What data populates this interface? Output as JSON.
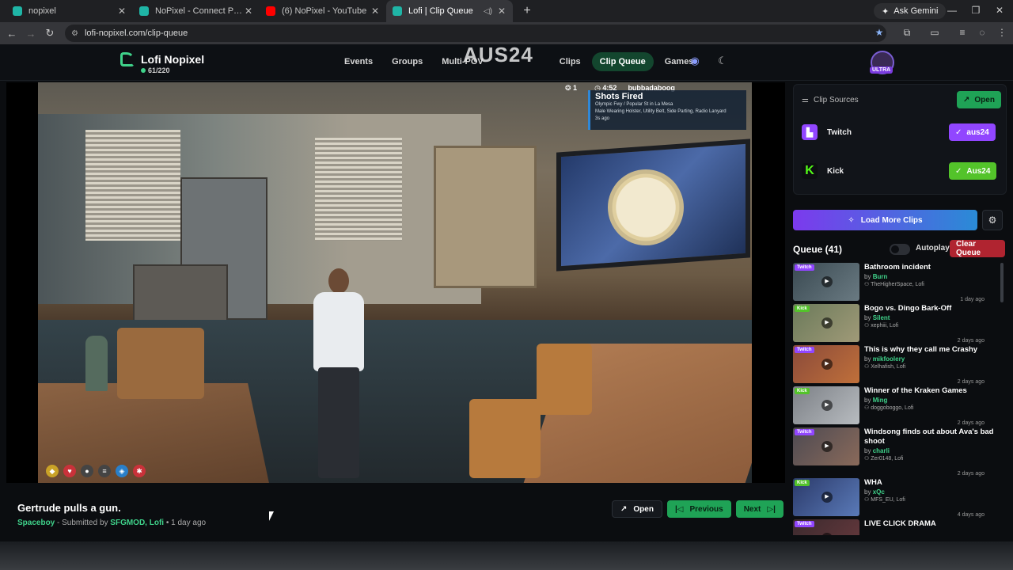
{
  "browser": {
    "tabs": [
      {
        "title": "nopixel",
        "color": "#1fb5a6",
        "active": false
      },
      {
        "title": "NoPixel - Connect Page",
        "color": "#1fb5a6",
        "active": false
      },
      {
        "title": "(6) NoPixel - YouTube",
        "color": "#ff0000",
        "active": false
      },
      {
        "title": "Lofi | Clip Queue",
        "color": "#1fb5a6",
        "active": true
      }
    ],
    "gemini_label": "Ask Gemini",
    "url": "lofi-nopixel.com/clip-queue"
  },
  "header": {
    "brand": "Lofi Nopixel",
    "online_count": "61/220",
    "nav": [
      {
        "label": "Events",
        "active": false
      },
      {
        "label": "Groups",
        "active": false
      },
      {
        "label": "Multi-POV",
        "active": false
      },
      {
        "label": "Clips",
        "active": false
      },
      {
        "label": "Clip Queue",
        "active": true
      },
      {
        "label": "Games",
        "active": false
      }
    ],
    "watermark": "AUS24",
    "avatar_badge": "ULTRA"
  },
  "video": {
    "hud": {
      "players": "1",
      "time": "4:52",
      "name": "bubbadaboog"
    },
    "alert": {
      "title": "Shots Fired",
      "lines": [
        "Olympic Fwy / Popular St in La Mesa",
        "Male Wearing Holster, Utility Belt, Side Parting, Radio Lanyard",
        "3s ago"
      ]
    }
  },
  "clip": {
    "title": "Gertrude pulls a gun.",
    "author": "Spaceboy",
    "submitted_prefix": "- Submitted by",
    "submitter": "SFGMOD, Lofi",
    "age": "• 1 day ago",
    "actions": {
      "open": "Open",
      "previous": "Previous",
      "next": "Next"
    }
  },
  "sources": {
    "heading": "Clip Sources",
    "open_label": "Open",
    "items": [
      {
        "name": "Twitch",
        "channel": "aus24",
        "chip_color": "#9146ff",
        "icon_color": "#9146ff"
      },
      {
        "name": "Kick",
        "channel": "Aus24",
        "chip_color": "#53c32a",
        "icon_color": "#53fc18"
      }
    ]
  },
  "load_more": "Load More Clips",
  "queue": {
    "heading": "Queue (41)",
    "autoplay": "Autoplay",
    "clear": "Clear Queue",
    "items": [
      {
        "title": "Bathroom incident",
        "by": "by",
        "author": "Burn",
        "sub": "TheHigherSpace, Lofi",
        "age": "1 day ago",
        "platform": "Twitch",
        "thumb": "#3a4a52"
      },
      {
        "title": "Bogo vs. Dingo Bark-Off",
        "by": "by",
        "author": "Silent",
        "sub": "xephiii, Lofi",
        "age": "2 days ago",
        "platform": "Kick",
        "thumb": "#6b7a5a"
      },
      {
        "title": "This is why they call me Crashy",
        "by": "by",
        "author": "mikfoolery",
        "sub": "Xelhafish, Lofi",
        "age": "2 days ago",
        "platform": "Twitch",
        "thumb": "#8a4a3a"
      },
      {
        "title": "Winner of the Kraken Games",
        "by": "by",
        "author": "Ming",
        "sub": "doggoboggo, Lofi",
        "age": "2 days ago",
        "platform": "Kick",
        "thumb": "#7c8086"
      },
      {
        "title": "Windsong finds out about Ava's bad shoot",
        "by": "by",
        "author": "charli",
        "sub": "Zer0148, Lofi",
        "age": "2 days ago",
        "platform": "Twitch",
        "thumb": "#4d4a52"
      },
      {
        "title": "WHA",
        "by": "by",
        "author": "xQc",
        "sub": "MFS_EU, Lofi",
        "age": "4 days ago",
        "platform": "Kick",
        "thumb": "#2b3a6a"
      },
      {
        "title": "LIVE CLICK DRAMA",
        "by": "by",
        "author": "",
        "sub": "",
        "age": "",
        "platform": "Twitch",
        "thumb": "#3b2a2e"
      }
    ]
  },
  "colors": {
    "accent_green": "#1fa356",
    "twitch": "#9146ff",
    "kick": "#53fc18",
    "danger": "#b02430"
  }
}
